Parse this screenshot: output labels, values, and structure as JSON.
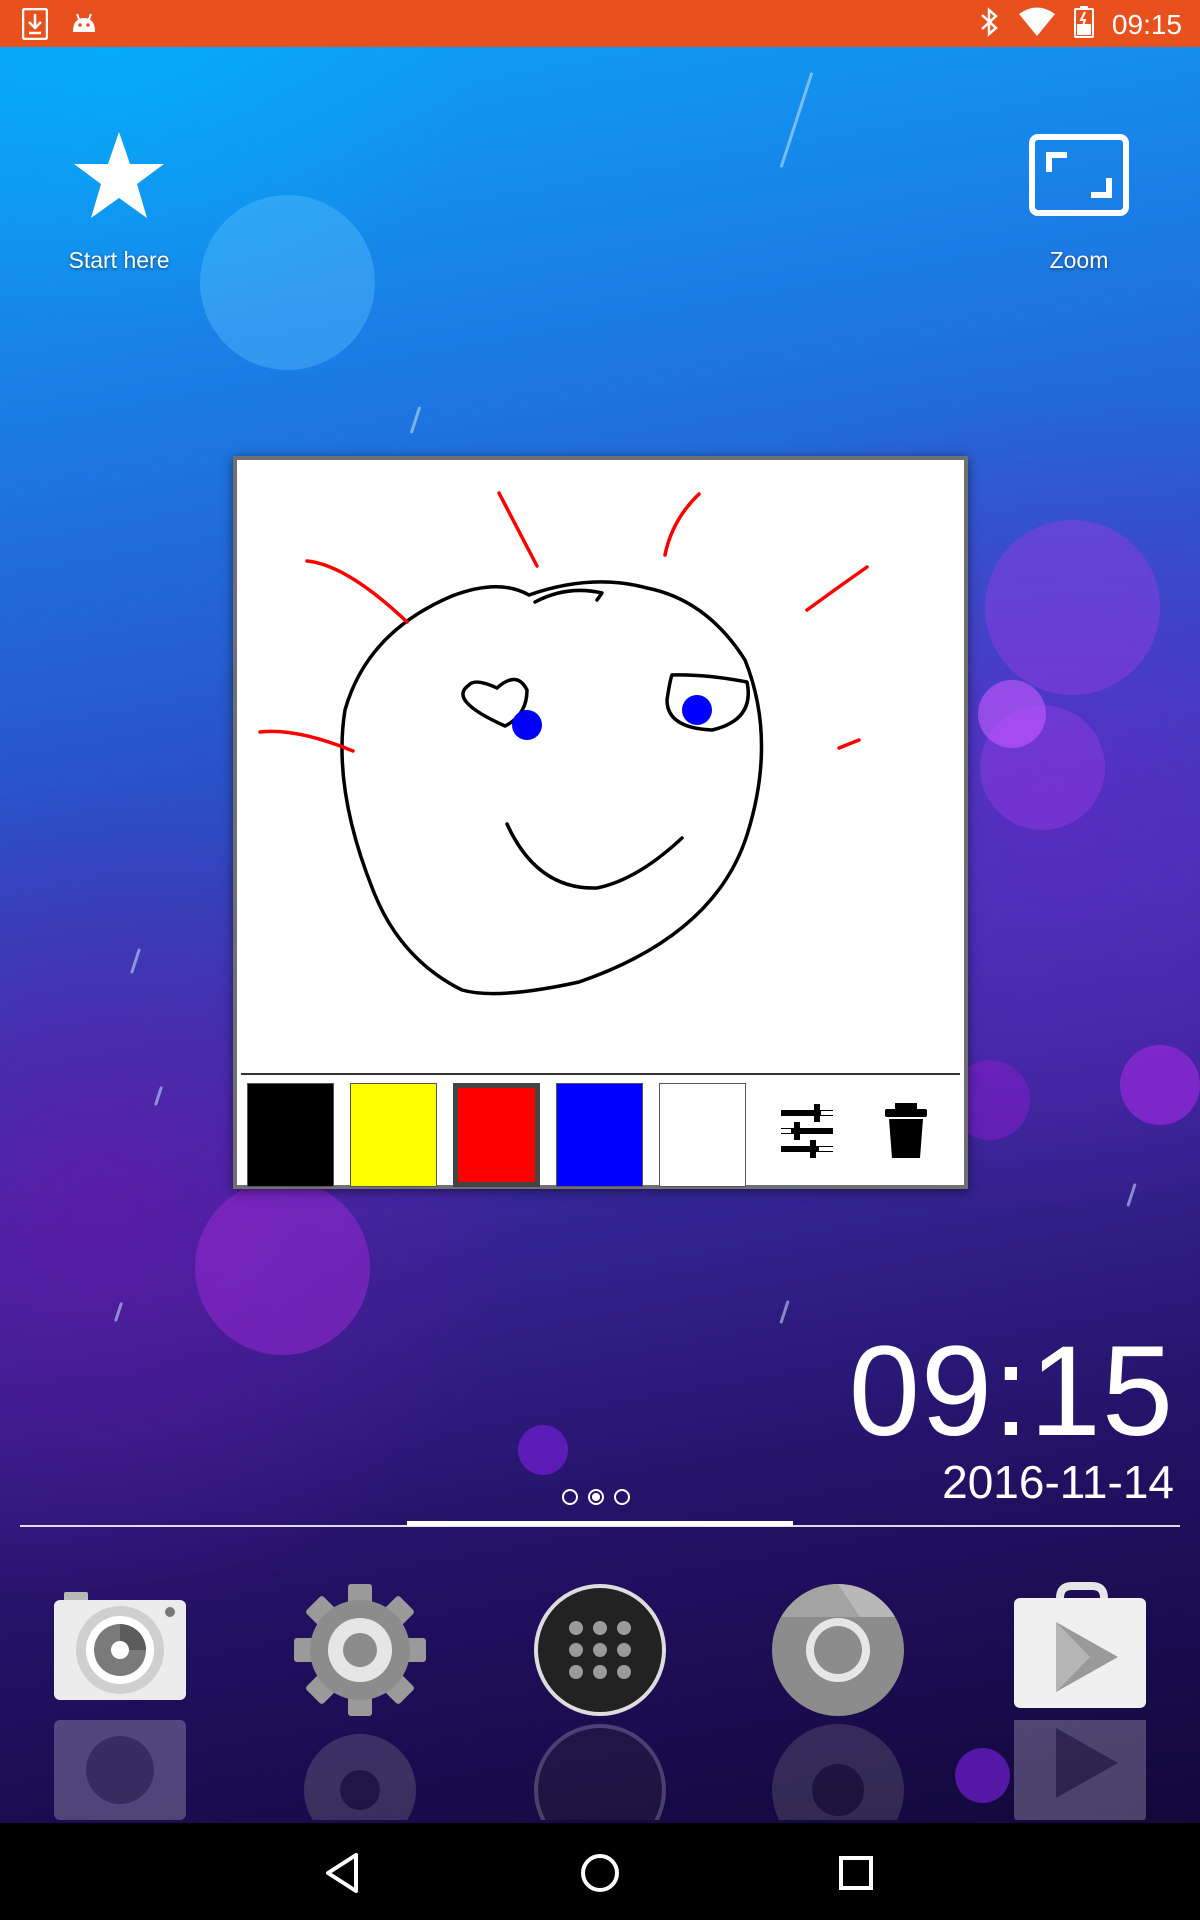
{
  "status_bar": {
    "time": "09:15",
    "icons": [
      "download-icon",
      "android-icon",
      "bluetooth-icon",
      "wifi-icon",
      "battery-icon"
    ],
    "color": "#e8501d"
  },
  "shortcuts": [
    {
      "label": "Start here",
      "icon": "star-icon"
    },
    {
      "label": "Zoom",
      "icon": "zoom-icon"
    }
  ],
  "drawing_widget": {
    "palette": [
      {
        "name": "black",
        "color": "#000000",
        "selected": false
      },
      {
        "name": "yellow",
        "color": "#ffff00",
        "selected": false
      },
      {
        "name": "red",
        "color": "#ff0000",
        "selected": true
      },
      {
        "name": "blue",
        "color": "#0000ff",
        "selected": false
      },
      {
        "name": "white",
        "color": "#ffffff",
        "selected": false
      }
    ],
    "tools": [
      "settings-sliders-icon",
      "trash-icon"
    ]
  },
  "clock_widget": {
    "time": "09:15",
    "date": "2016-11-14"
  },
  "page_indicator": {
    "count": 3,
    "active": 2
  },
  "dock": [
    "camera-icon",
    "settings-icon",
    "app-drawer-icon",
    "chrome-icon",
    "play-store-icon"
  ],
  "nav_bar": [
    "back-icon",
    "home-icon",
    "recents-icon"
  ]
}
